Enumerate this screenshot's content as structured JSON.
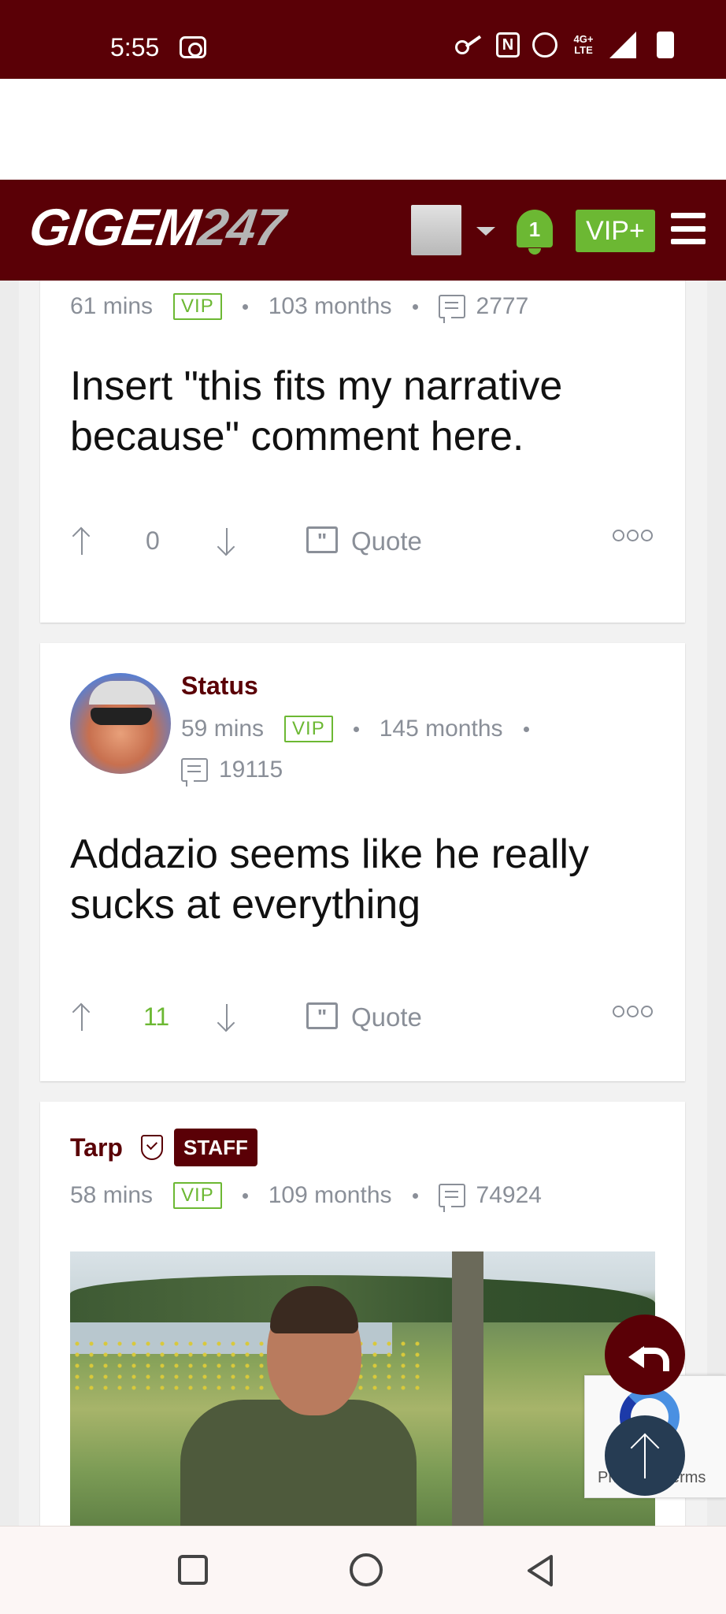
{
  "status_bar": {
    "time": "5:55",
    "network": "4G+ LTE"
  },
  "header": {
    "logo_main": "GIGEM",
    "logo_num": "247",
    "notification_count": "1",
    "vip_button": "VIP+"
  },
  "posts": [
    {
      "time": "61 mins",
      "badge": "VIP",
      "tenure": "103 months",
      "comment_count": "2777",
      "text": "Insert \"this fits my narrative because\" comment here.",
      "votes": "0",
      "quote_label": "Quote"
    },
    {
      "username": "Status",
      "time": "59 mins",
      "badge": "VIP",
      "tenure": "145 months",
      "comment_count": "19115",
      "text": "Addazio seems like he really sucks at everything",
      "votes": "11",
      "quote_label": "Quote"
    },
    {
      "username": "Tarp",
      "staff_badge": "STAFF",
      "time": "58 mins",
      "badge": "VIP",
      "tenure": "109 months",
      "comment_count": "74924"
    }
  ],
  "recaptcha": {
    "text": "Privacy - Terms"
  },
  "colors": {
    "brand": "#5a0006",
    "accent_green": "#6cb833",
    "meta_gray": "#8a8f98",
    "scroll_top_button": "#263c53"
  }
}
